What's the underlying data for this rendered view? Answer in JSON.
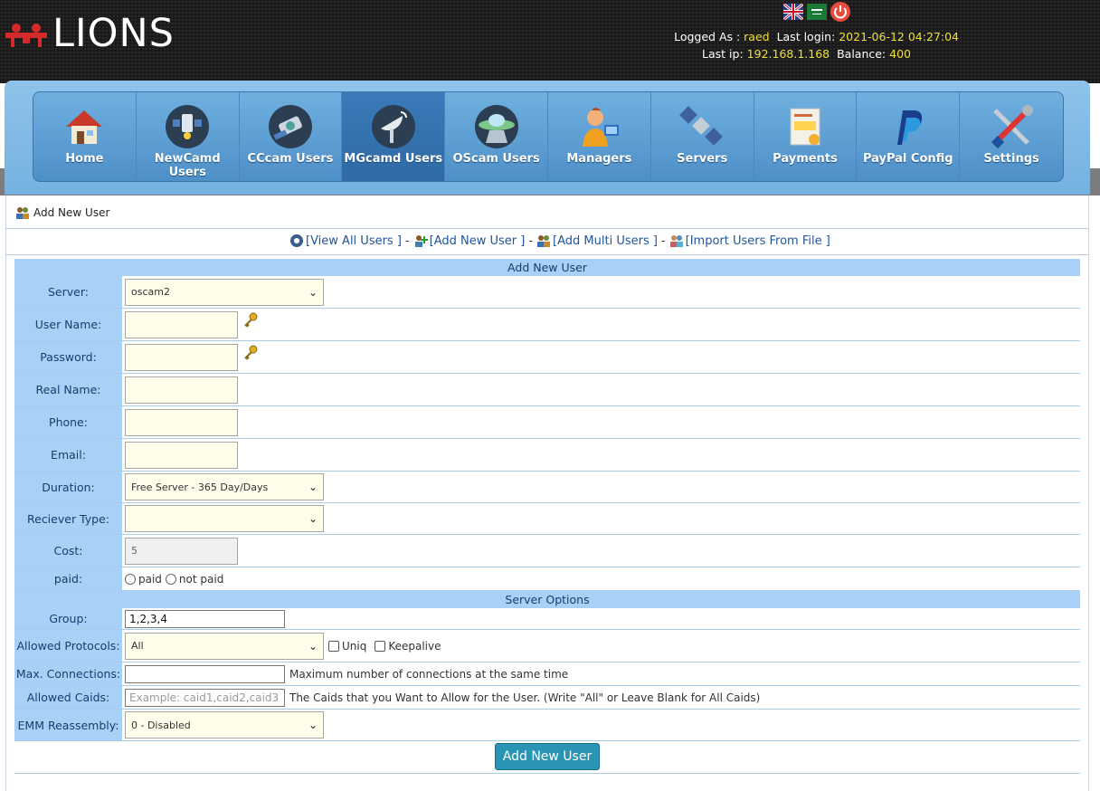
{
  "header": {
    "logo": "LIONS",
    "logged_as_label": "Logged As :",
    "username": "raed",
    "last_login_label": "Last login:",
    "last_login": "2021-06-12 04:27:04",
    "last_ip_label": "Last ip:",
    "last_ip": "192.168.1.168",
    "balance_label": "Balance:",
    "balance": "400"
  },
  "nav": {
    "items": [
      {
        "label": "Home",
        "icon": "house-icon"
      },
      {
        "label": "NewCamd Users",
        "icon": "satellite-dish-icon"
      },
      {
        "label": "CCcam Users",
        "icon": "satellite-icon"
      },
      {
        "label": "MGcamd Users",
        "icon": "antenna-icon",
        "active": true
      },
      {
        "label": "OScam Users",
        "icon": "ufo-icon"
      },
      {
        "label": "Managers",
        "icon": "manager-icon"
      },
      {
        "label": "Servers",
        "icon": "server-satellite-icon"
      },
      {
        "label": "Payments",
        "icon": "payment-icon"
      },
      {
        "label": "PayPal Config",
        "icon": "paypal-icon"
      },
      {
        "label": "Settings",
        "icon": "tools-icon"
      }
    ]
  },
  "breadcrumb": "Add New User",
  "links": {
    "view_all": "[View All Users ]",
    "add_new": "[Add New User ]",
    "add_multi": "[Add Multi Users ]",
    "import": "[Import Users From File ]",
    "sep": "-"
  },
  "form": {
    "title": "Add New User",
    "server_label": "Server:",
    "server_value": "oscam2",
    "username_label": "User Name:",
    "password_label": "Password:",
    "realname_label": "Real Name:",
    "phone_label": "Phone:",
    "email_label": "Email:",
    "duration_label": "Duration:",
    "duration_value": "Free Server - 365 Day/Days",
    "receiver_label": "Reciever Type:",
    "receiver_value": "",
    "cost_label": "Cost:",
    "cost_value": "5",
    "paid_label": "paid:",
    "paid_option": "paid",
    "not_paid_option": "not paid"
  },
  "server_options": {
    "title": "Server Options",
    "group_label": "Group:",
    "group_value": "1,2,3,4",
    "protocols_label": "Allowed Protocols:",
    "protocols_value": "All",
    "uniq_label": "Uniq",
    "keepalive_label": "Keepalive",
    "max_conn_label": "Max. Connections:",
    "max_conn_help": "Maximum number of connections at the same time",
    "caids_label": "Allowed Caids:",
    "caids_placeholder": "Example: caid1,caid2,caid3",
    "caids_help": "The Caids that you Want to Allow for the User. (Write \"All\" or Leave Blank for All Caids)",
    "emm_label": "EMM Reassembly:",
    "emm_value": "0 - Disabled",
    "submit_label": "Add New User"
  },
  "colors": {
    "header_bg": "#1a1a1a",
    "highlight": "#f0e030",
    "nav_blue": "#4e8fc8",
    "label_bg": "#a8d1f7",
    "button": "#2a94b4"
  }
}
